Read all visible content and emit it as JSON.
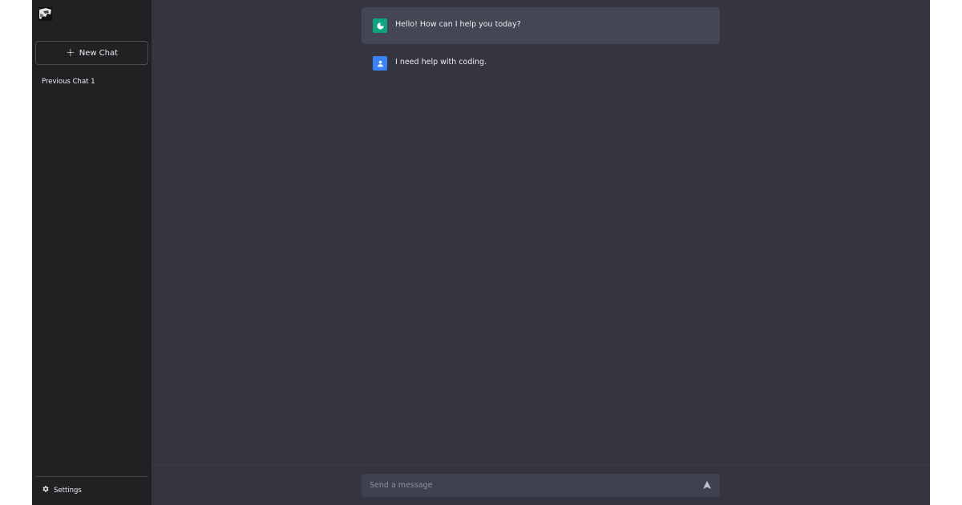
{
  "sidebar": {
    "new_chat_label": "New Chat",
    "history": [
      {
        "label": "Previous Chat 1"
      }
    ],
    "settings_label": "Settings"
  },
  "messages": [
    {
      "role": "assistant",
      "text": "Hello! How can I help you today?"
    },
    {
      "role": "user",
      "text": "I need help with coding."
    }
  ],
  "composer": {
    "placeholder": "Send a message",
    "value": ""
  },
  "colors": {
    "sidebar_bg": "#202123",
    "main_bg": "#343541",
    "assistant_bubble": "#444654",
    "assistant_avatar": "#10a37f",
    "user_avatar": "#3b82f6"
  },
  "icons": {
    "logo": "app-logo",
    "plus": "plus-icon",
    "settings": "gear-icon",
    "assistant_avatar": "assistant-avatar-icon",
    "user_avatar": "user-avatar-icon",
    "send": "send-icon"
  }
}
